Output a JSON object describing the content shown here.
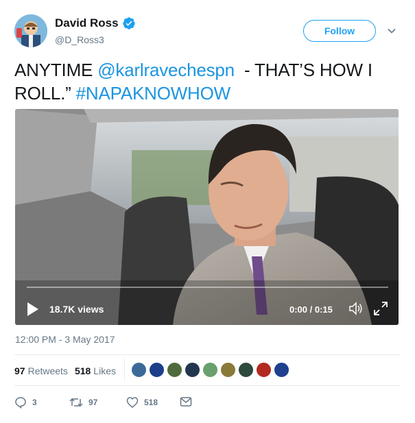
{
  "user": {
    "name": "David Ross",
    "handle": "@D_Ross3",
    "verified": true
  },
  "follow_label": "Follow",
  "tweet": {
    "text_parts": [
      {
        "text": "ANYTIME ",
        "type": "plain"
      },
      {
        "text": "@karlravechespn",
        "type": "mention"
      },
      {
        "text": "  - THAT’S HOW I ROLL.” ",
        "type": "plain"
      },
      {
        "text": "#NAPAKNOWHOW",
        "type": "hashtag"
      }
    ]
  },
  "video": {
    "views": "18.7K views",
    "time": "0:00 / 0:15",
    "progress": 0
  },
  "timestamp": "12:00 PM - 3 May 2017",
  "stats": {
    "retweets_count": "97",
    "retweets_label": "Retweets",
    "likes_count": "518",
    "likes_label": "Likes"
  },
  "likers": [
    "#3b6a9a",
    "#1d3f8a",
    "#4f6b3d",
    "#22364f",
    "#6a9f6e",
    "#8a7a3a",
    "#2d4a3c",
    "#b32a20",
    "#1f3f8f"
  ],
  "actions": {
    "reply_count": "3",
    "retweet_count": "97",
    "like_count": "518"
  },
  "colors": {
    "link": "#1b95e0",
    "follow": "#1da1f2",
    "muted": "#657786"
  },
  "icons": [
    "verified-badge-icon",
    "chevron-down-icon",
    "play-icon",
    "volume-icon",
    "expand-icon",
    "reply-icon",
    "retweet-icon",
    "heart-icon",
    "message-icon"
  ]
}
